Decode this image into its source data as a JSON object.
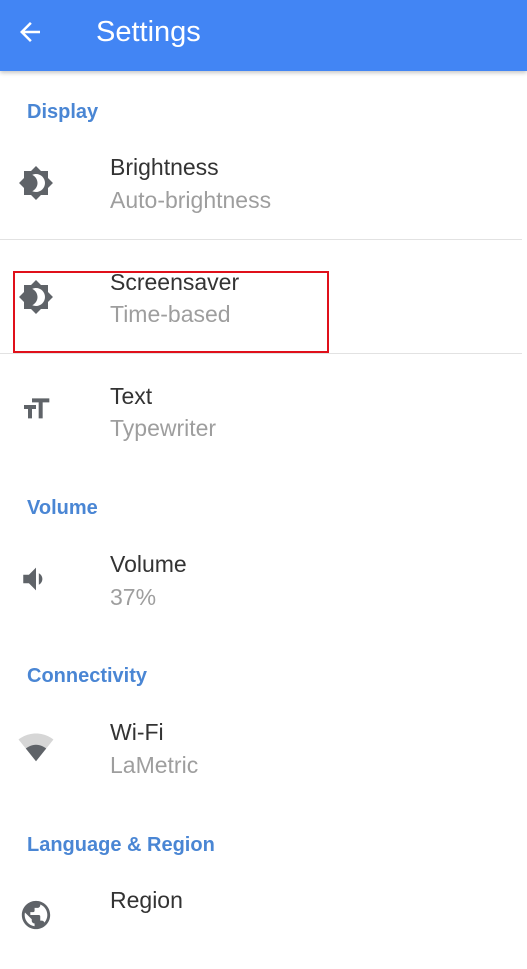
{
  "appbar": {
    "title": "Settings",
    "back_icon": "arrow-back-icon",
    "background_color": "#4285f4"
  },
  "sections": {
    "display": "Display",
    "volume": "Volume",
    "connectivity": "Connectivity",
    "language_region": "Language & Region"
  },
  "items": {
    "brightness": {
      "label": "Brightness",
      "value": "Auto-brightness",
      "icon": "brightness-icon"
    },
    "screensaver": {
      "label": "Screensaver",
      "value": "Time-based",
      "icon": "brightness-icon"
    },
    "text": {
      "label": "Text",
      "value": "Typewriter",
      "icon": "text-size-icon"
    },
    "volume": {
      "label": "Volume",
      "value": "37%",
      "icon": "volume-icon"
    },
    "wifi": {
      "label": "Wi-Fi",
      "value": "LaMetric",
      "icon": "wifi-icon"
    },
    "region": {
      "label": "Region",
      "icon": "globe-icon"
    }
  },
  "colors": {
    "section_header": "#4a86d4",
    "highlight": "#e0101a"
  }
}
